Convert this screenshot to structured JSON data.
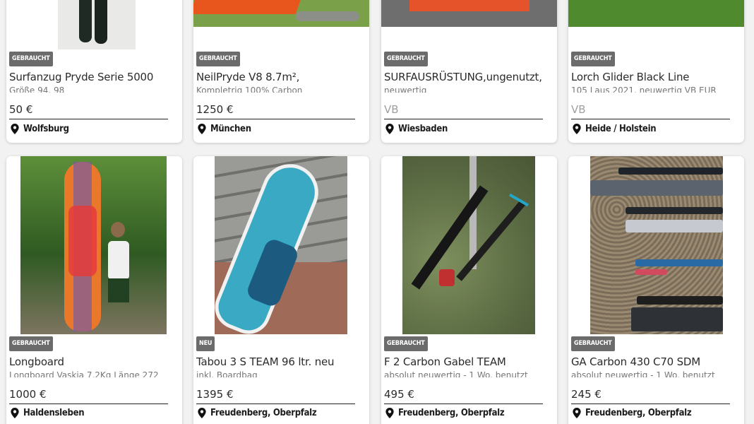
{
  "listings": [
    {
      "badge": "GEBRAUCHT",
      "title": "Surfanzug Pryde Serie 5000",
      "desc": "Größe 94, 98",
      "price": "50 €",
      "location": "Wolfsburg",
      "price_is_vb": false
    },
    {
      "badge": "GEBRAUCHT",
      "title": "NeilPryde V8 8.7m²,",
      "desc": "Kompletrig 100% Carbon",
      "price": "1250 €",
      "location": "München",
      "price_is_vb": false
    },
    {
      "badge": "GEBRAUCHT",
      "title": "SURFAUSRÜSTUNG,ungenutzt,",
      "desc": "neuwertig",
      "price": "VB",
      "location": "Wiesbaden",
      "price_is_vb": true
    },
    {
      "badge": "GEBRAUCHT",
      "title": "Lorch Glider Black Line",
      "desc": "105 Laus 2021, neuwertig VB EUR",
      "price": "VB",
      "location": "Heide / Holstein",
      "price_is_vb": true
    },
    {
      "badge": "GEBRAUCHT",
      "title": "Longboard",
      "desc": "Longboard Vaskia 7,2Kg Länge 272",
      "price": "1000 €",
      "location": "Haldensleben",
      "price_is_vb": false
    },
    {
      "badge": "NEU",
      "title": "Tabou 3 S TEAM 96 ltr. neu",
      "desc": "inkl. Boardbag",
      "price": "1395 €",
      "location": "Freudenberg, Oberpfalz",
      "price_is_vb": false
    },
    {
      "badge": "GEBRAUCHT",
      "title": "F 2 Carbon Gabel TEAM",
      "desc": "absolut neuwertig - 1 Wo. benutzt",
      "price": "495 €",
      "location": "Freudenberg, Oberpfalz",
      "price_is_vb": false
    },
    {
      "badge": "GEBRAUCHT",
      "title": "GA Carbon 430 C70 SDM",
      "desc": "absolut neuwertig - 1 Wo. benutzt",
      "price": "245 €",
      "location": "Freudenberg, Oberpfalz",
      "price_is_vb": false
    }
  ],
  "icons": {
    "location": "map-pin-icon"
  },
  "colors": {
    "badge": "#6b6b6b",
    "card": "#ffffff",
    "background": "#f2f2f2",
    "vb_price": "#a0a0a0"
  }
}
